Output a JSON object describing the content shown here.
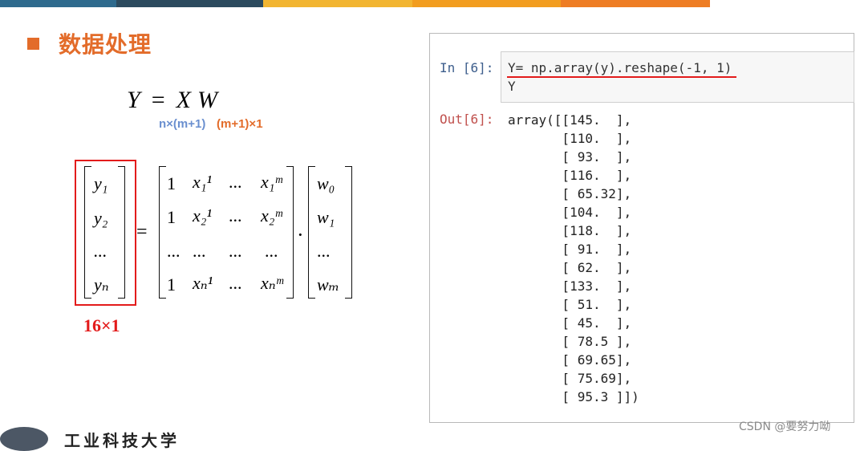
{
  "colors": {
    "accent_orange": "#e36c2a",
    "accent_blue": "#6a8fcf",
    "highlight_red": "#e31b1b",
    "topbar": [
      "#2e6a8d",
      "#2c4a5e",
      "#f2b531",
      "#f29d1f",
      "#ee7d24"
    ]
  },
  "slide": {
    "title": "数据处理",
    "equation": {
      "lhs": "Y",
      "eq": "=",
      "x": "X",
      "w": "W"
    },
    "dims": {
      "x_dim": "n×(m+1)",
      "w_dim": "(m+1)×1"
    },
    "matrix_y": [
      "y₁",
      "y₂",
      "...",
      "yₙ"
    ],
    "matrix_x_rows": [
      [
        "1",
        "x₁¹",
        "...",
        "x₁ᵐ"
      ],
      [
        "1",
        "x₂¹",
        "...",
        "x₂ᵐ"
      ],
      [
        "...",
        "...",
        "...",
        "..."
      ],
      [
        "1",
        "xₙ¹",
        "...",
        "xₙᵐ"
      ]
    ],
    "matrix_w": [
      "w₀",
      "w₁",
      "...",
      "wₘ"
    ],
    "eq_sign": "=",
    "dot": "·",
    "size_label": "16×1",
    "logo_text": "工业科技大学"
  },
  "notebook": {
    "in_prompt": "In [6]:",
    "code_lines": [
      "Y= np.array(y).reshape(-1, 1)",
      "Y"
    ],
    "out_prompt": "Out[6]:",
    "output_lines": [
      "array([[145.  ],",
      "       [110.  ],",
      "       [ 93.  ],",
      "       [116.  ],",
      "       [ 65.32],",
      "       [104.  ],",
      "       [118.  ],",
      "       [ 91.  ],",
      "       [ 62.  ],",
      "       [133.  ],",
      "       [ 51.  ],",
      "       [ 45.  ],",
      "       [ 78.5 ],",
      "       [ 69.65],",
      "       [ 75.69],",
      "       [ 95.3 ]])"
    ]
  },
  "watermark": "CSDN @要努力呦"
}
